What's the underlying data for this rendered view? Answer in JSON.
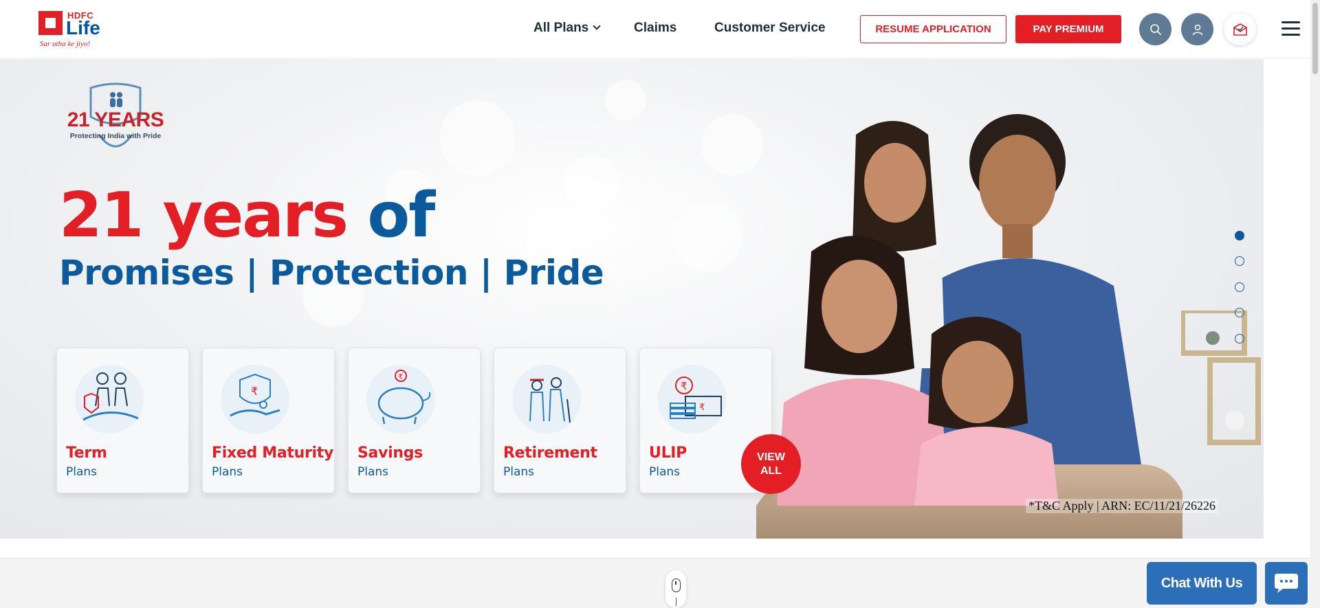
{
  "header": {
    "logo": {
      "brand": "HDFC",
      "name": "Life",
      "tagline": "Sar utha ke jiyo!"
    },
    "nav": {
      "all_plans": "All Plans",
      "claims": "Claims",
      "customer_service": "Customer Service"
    },
    "buttons": {
      "resume": "RESUME APPLICATION",
      "pay": "PAY PREMIUM"
    },
    "icons": [
      "search-icon",
      "user-icon",
      "mail-icon",
      "hamburger-menu-icon"
    ]
  },
  "hero": {
    "badge": {
      "title": "21 YEARS",
      "subtitle": "Protecting India with Pride"
    },
    "headline_red": "21 years",
    "headline_blue": "of",
    "subheadline": "Promises | Protection | Pride",
    "cards": [
      {
        "title": "Term",
        "sub": "Plans",
        "icon": "family-protection-icon"
      },
      {
        "title": "Fixed Maturity",
        "sub": "Plans",
        "icon": "shield-hand-icon"
      },
      {
        "title": "Savings",
        "sub": "Plans",
        "icon": "piggy-bank-icon"
      },
      {
        "title": "Retirement",
        "sub": "Plans",
        "icon": "elderly-couple-icon"
      },
      {
        "title": "ULIP",
        "sub": "Plans",
        "icon": "money-coins-icon"
      }
    ],
    "view_all_line1": "VIEW",
    "view_all_line2": "ALL",
    "tnc": "*T&C Apply | ARN: EC/11/21/26226",
    "slides": {
      "count": 5,
      "active": 1
    }
  },
  "chat": {
    "label": "Chat With Us"
  },
  "colors": {
    "red": "#e31e24",
    "blue": "#0a5a9c",
    "chat_blue": "#2c6fb9"
  }
}
